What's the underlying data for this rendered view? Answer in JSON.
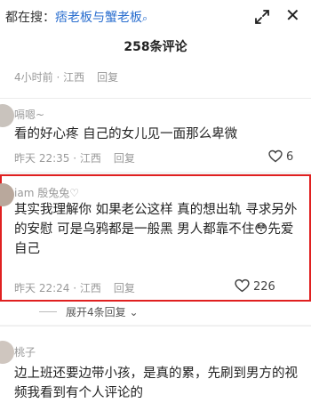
{
  "search": {
    "prefix": "都在搜：",
    "keyword": "痞老板与蟹老板",
    "icon": "search-icon"
  },
  "comment_count": "258条评论",
  "comments": [
    {
      "time": "4小时前 · 江西",
      "reply_label": "回复"
    },
    {
      "username": "嗝嗯~",
      "text": "看的好心疼 自己的女儿见一面那么卑微",
      "time": "昨天 22:35 · 江西",
      "reply_label": "回复",
      "likes": "6"
    },
    {
      "username": "iam 殷兔兔♡",
      "text": "其实我理解你 如果老公这样 真的想出轨 寻求另外的安慰 可是乌鸦都是一般黑 男人都靠不住😳先爱自己",
      "time": "昨天 22:24 · 江西",
      "reply_label": "回复",
      "likes": "226",
      "expand_replies": "展开4条回复 ⌄"
    },
    {
      "username": "桃子",
      "text": "边上班还要边带小孩，是真的累，先刷到男方的视频我看到有个人评论的"
    }
  ],
  "colors": {
    "highlight_border": "#e02020",
    "search_keyword": "#2a6ecf",
    "meta_text": "#999999"
  }
}
